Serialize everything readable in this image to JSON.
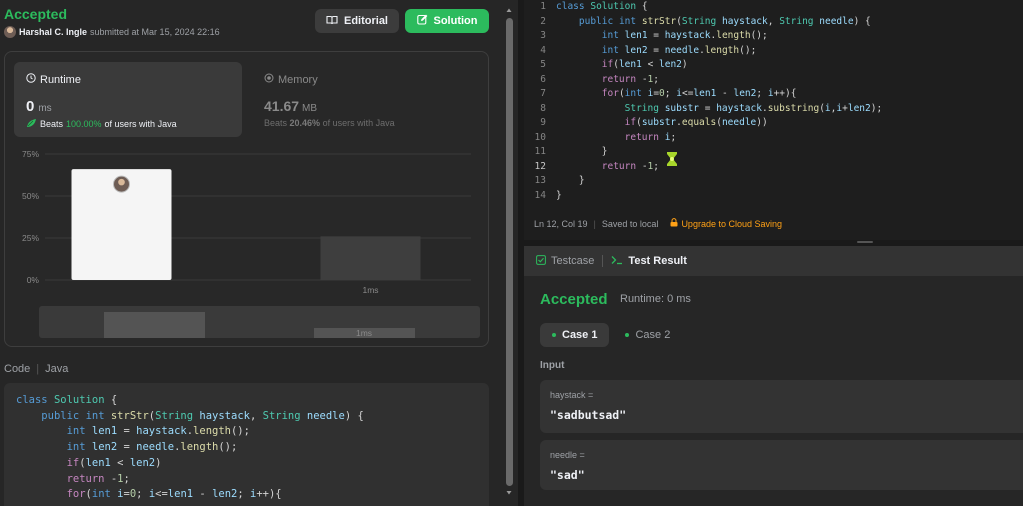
{
  "submission": {
    "status": "Accepted",
    "user": "Harshal C. Ingle",
    "submitted_text": "submitted at Mar 15, 2024 22:16",
    "editorial_label": "Editorial",
    "solution_label": "Solution"
  },
  "runtime": {
    "label": "Runtime",
    "value": "0",
    "unit": "ms",
    "beats_prefix": "Beats",
    "beats_pct": "100.00%",
    "beats_suffix": "of users with Java"
  },
  "memory": {
    "label": "Memory",
    "value": "41.67",
    "unit": "MB",
    "beats_prefix": "Beats",
    "beats_pct": "20.46%",
    "beats_suffix": "of users with Java"
  },
  "chart_data": {
    "type": "bar",
    "categories": [
      "0ms",
      "1ms"
    ],
    "x_tick_labels": [
      "",
      "1ms"
    ],
    "values": [
      66,
      26
    ],
    "highlight_index": 0,
    "y_ticks": [
      "0%",
      "25%",
      "50%",
      "75%"
    ],
    "ylim": [
      0,
      75
    ],
    "grid": true,
    "overview_labels": [
      "1ms"
    ],
    "colors": {
      "highlight": "#f5f5f5",
      "bar": "#3e3e3e"
    }
  },
  "code_section": {
    "label": "Code",
    "language": "Java",
    "lines": [
      "class Solution {",
      "    public int strStr(String haystack, String needle) {",
      "        int len1 = haystack.length();",
      "        int len2 = needle.length();",
      "        if(len1 < len2)",
      "        return -1;",
      "        for(int i=0; i<=len1 - len2; i++){"
    ]
  },
  "editor": {
    "active_line": 12,
    "lines": [
      "class Solution {",
      "    public int strStr(String haystack, String needle) {",
      "        int len1 = haystack.length();",
      "        int len2 = needle.length();",
      "        if(len1 < len2)",
      "        return -1;",
      "        for(int i=0; i<=len1 - len2; i++){",
      "            String substr = haystack.substring(i,i+len2);",
      "            if(substr.equals(needle))",
      "            return i;",
      "        }",
      "        return -1;",
      "    }",
      "}"
    ],
    "cursor_pos": "Ln 12, Col 19",
    "saved_text": "Saved to local",
    "upgrade_text": "Upgrade to Cloud Saving"
  },
  "result": {
    "tab_testcase": "Testcase",
    "tab_testresult": "Test Result",
    "status": "Accepted",
    "runtime": "Runtime: 0 ms",
    "cases": [
      "Case 1",
      "Case 2"
    ],
    "input_label": "Input",
    "inputs": [
      {
        "name": "haystack =",
        "value": "\"sadbutsad\""
      },
      {
        "name": "needle =",
        "value": "\"sad\""
      }
    ]
  }
}
